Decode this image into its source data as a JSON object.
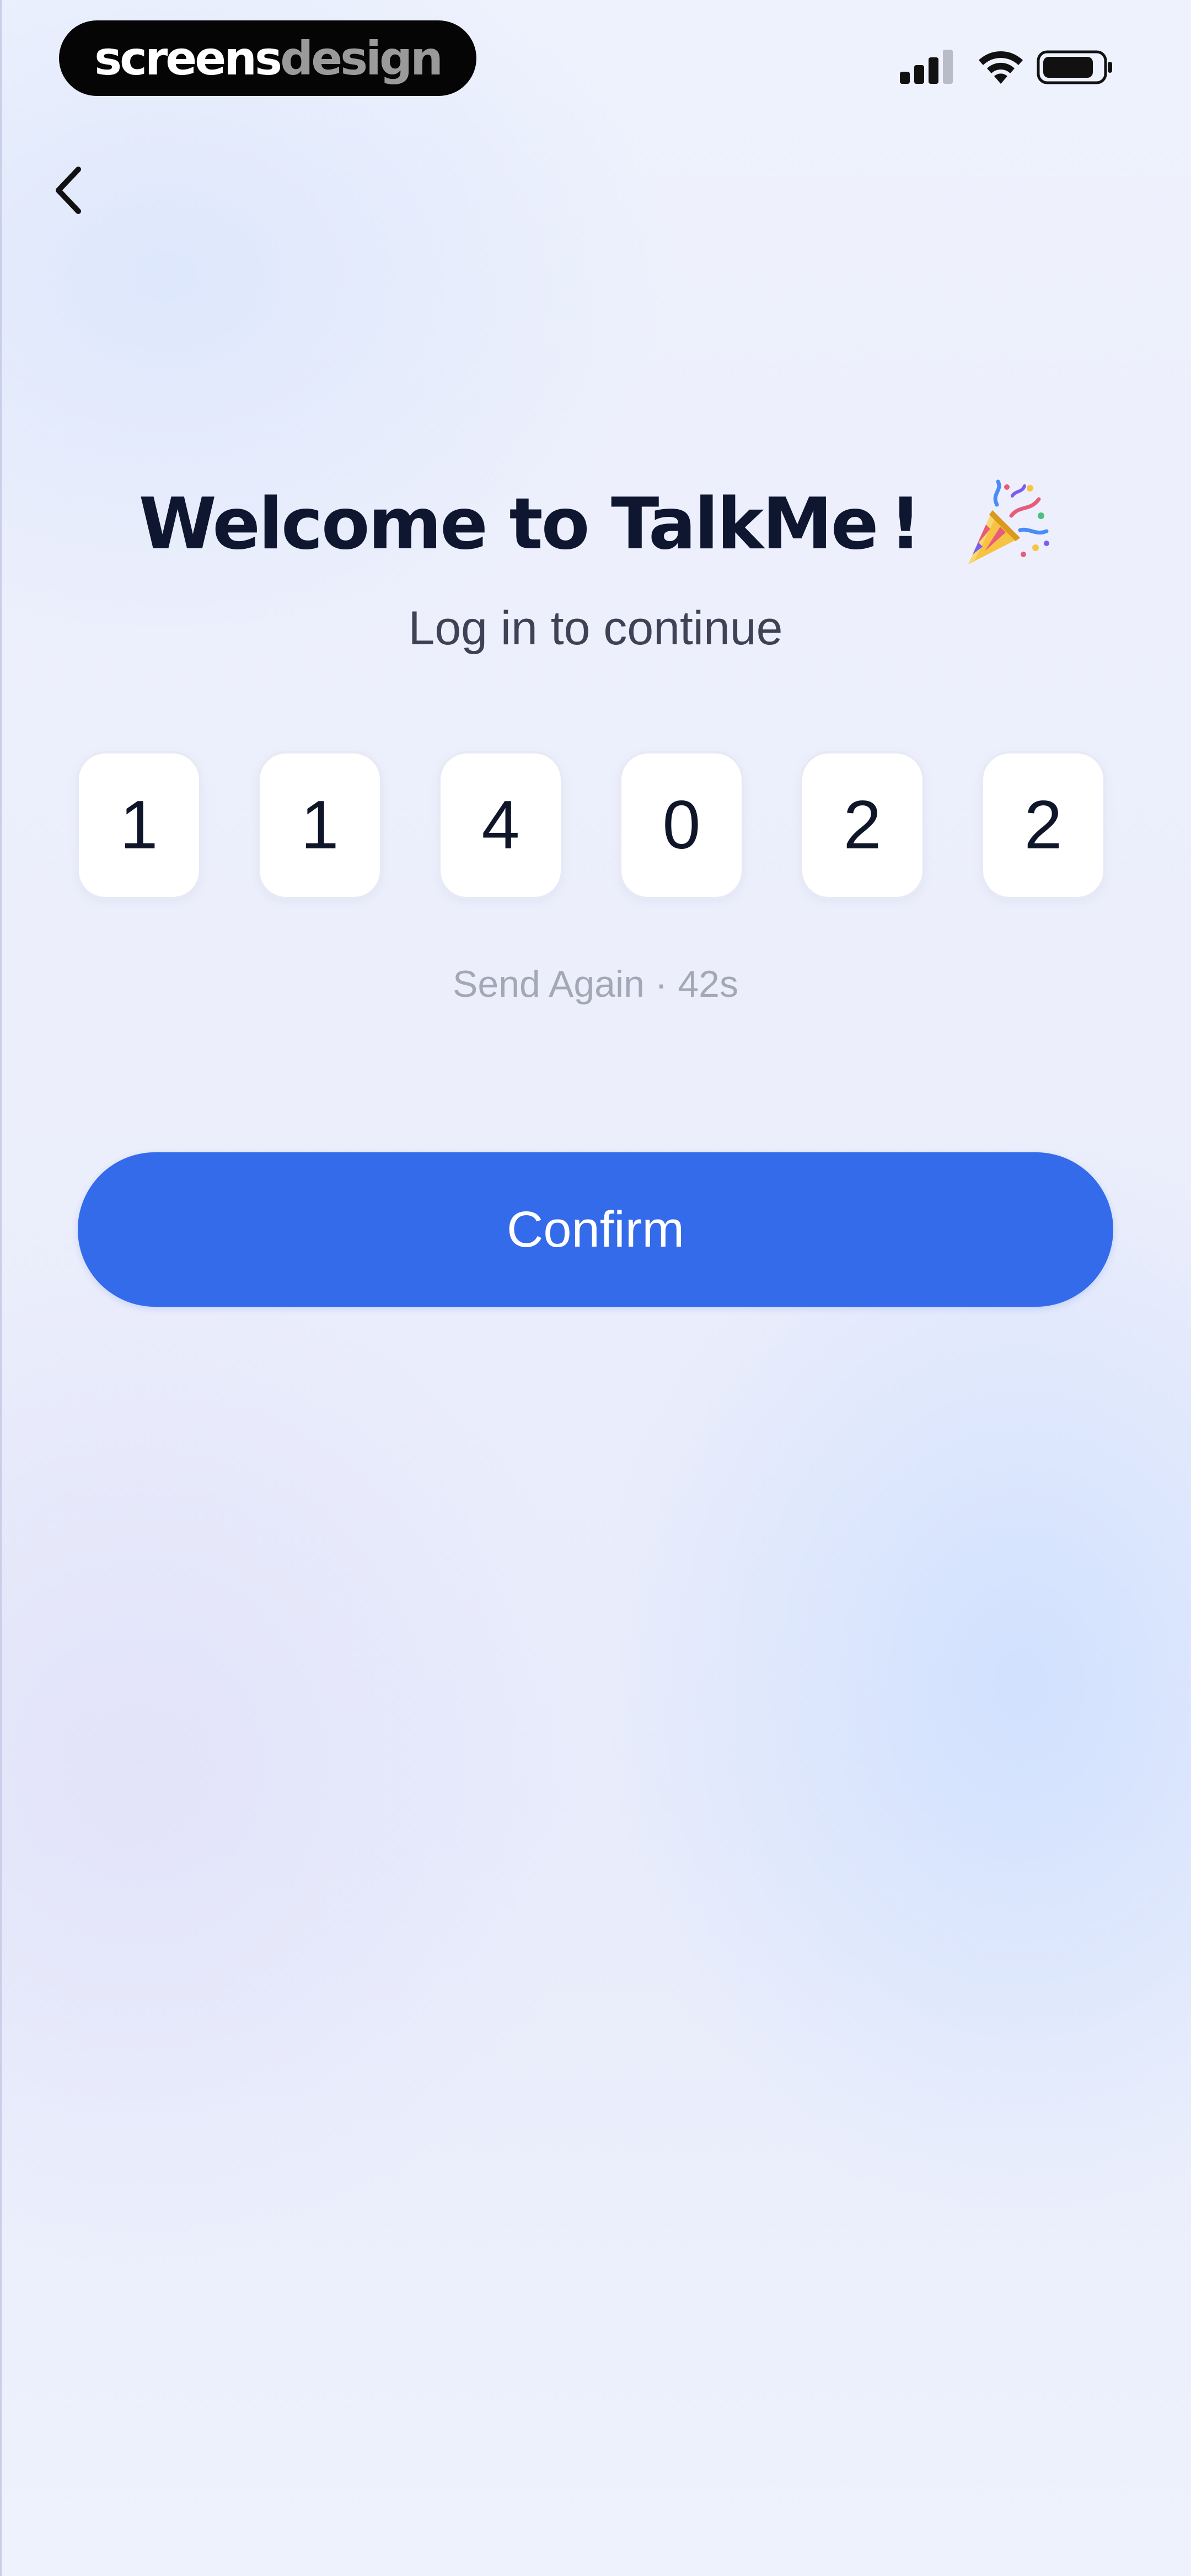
{
  "watermark": {
    "part1": "screens",
    "part2": "design"
  },
  "status_bar": {
    "icons": [
      "cellular-signal-icon",
      "wifi-icon",
      "battery-icon"
    ]
  },
  "nav": {
    "back_icon": "chevron-left-icon"
  },
  "header": {
    "title": "Welcome to TalkMe !",
    "emoji_icon": "party-popper-icon",
    "subtitle": "Log in to continue"
  },
  "code": {
    "digits": [
      "1",
      "1",
      "4",
      "0",
      "2",
      "2"
    ]
  },
  "resend": {
    "label": "Send Again · 42s"
  },
  "actions": {
    "confirm_label": "Confirm"
  },
  "colors": {
    "primary": "#346bea",
    "title": "#0e1630",
    "subtitle": "#3f4254",
    "muted": "#a4a7b6"
  }
}
